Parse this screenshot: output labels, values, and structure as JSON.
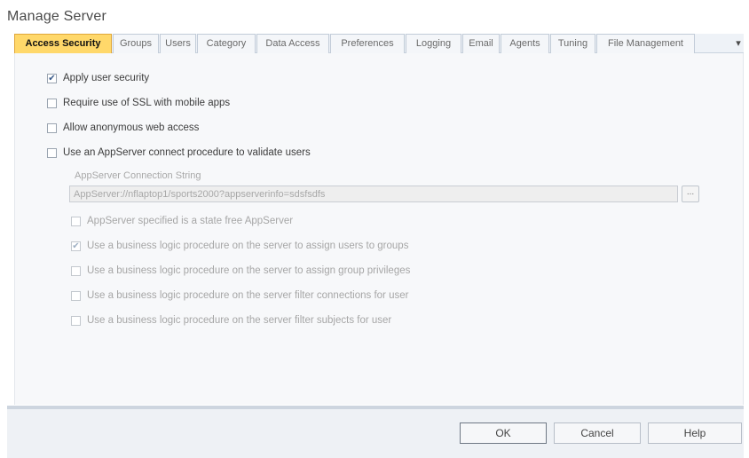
{
  "window": {
    "title": "Manage Server"
  },
  "tabs": [
    {
      "label": "Access Security",
      "active": true
    },
    {
      "label": "Groups"
    },
    {
      "label": "Users"
    },
    {
      "label": "Category"
    },
    {
      "label": "Data Access"
    },
    {
      "label": "Preferences"
    },
    {
      "label": "Logging"
    },
    {
      "label": "Email"
    },
    {
      "label": "Agents"
    },
    {
      "label": "Tuning"
    },
    {
      "label": "File Management"
    }
  ],
  "tab_scroll_glyph": "▾",
  "access_security": {
    "apply_user_security": {
      "label": "Apply user security",
      "checked": true
    },
    "require_ssl": {
      "label": "Require use of SSL with mobile apps",
      "checked": false
    },
    "allow_anonymous": {
      "label": "Allow anonymous web access",
      "checked": false
    },
    "use_appserver": {
      "label": "Use an AppServer connect procedure to validate users",
      "checked": false
    },
    "connection_string_label": "AppServer Connection String",
    "connection_string_value": "AppServer://nflaptop1/sports2000?appserverinfo=sdsfsdfs",
    "browse_label": "...",
    "state_free": {
      "label": "AppServer specified is a state free AppServer",
      "checked": false
    },
    "assign_groups": {
      "label": "Use a business logic procedure on the server to assign users to groups",
      "checked": true
    },
    "assign_privileges": {
      "label": "Use a business logic procedure on the server to assign group privileges",
      "checked": false
    },
    "filter_connections": {
      "label": "Use a business logic procedure on the server filter connections for user",
      "checked": false
    },
    "filter_subjects": {
      "label": "Use a business logic procedure on the server filter subjects for user",
      "checked": false
    }
  },
  "buttons": {
    "ok": "OK",
    "cancel": "Cancel",
    "help": "Help"
  },
  "colors": {
    "active_tab": "#ffd86a",
    "active_tab_border": "#e0a73a",
    "footer": "#eef1f5"
  }
}
